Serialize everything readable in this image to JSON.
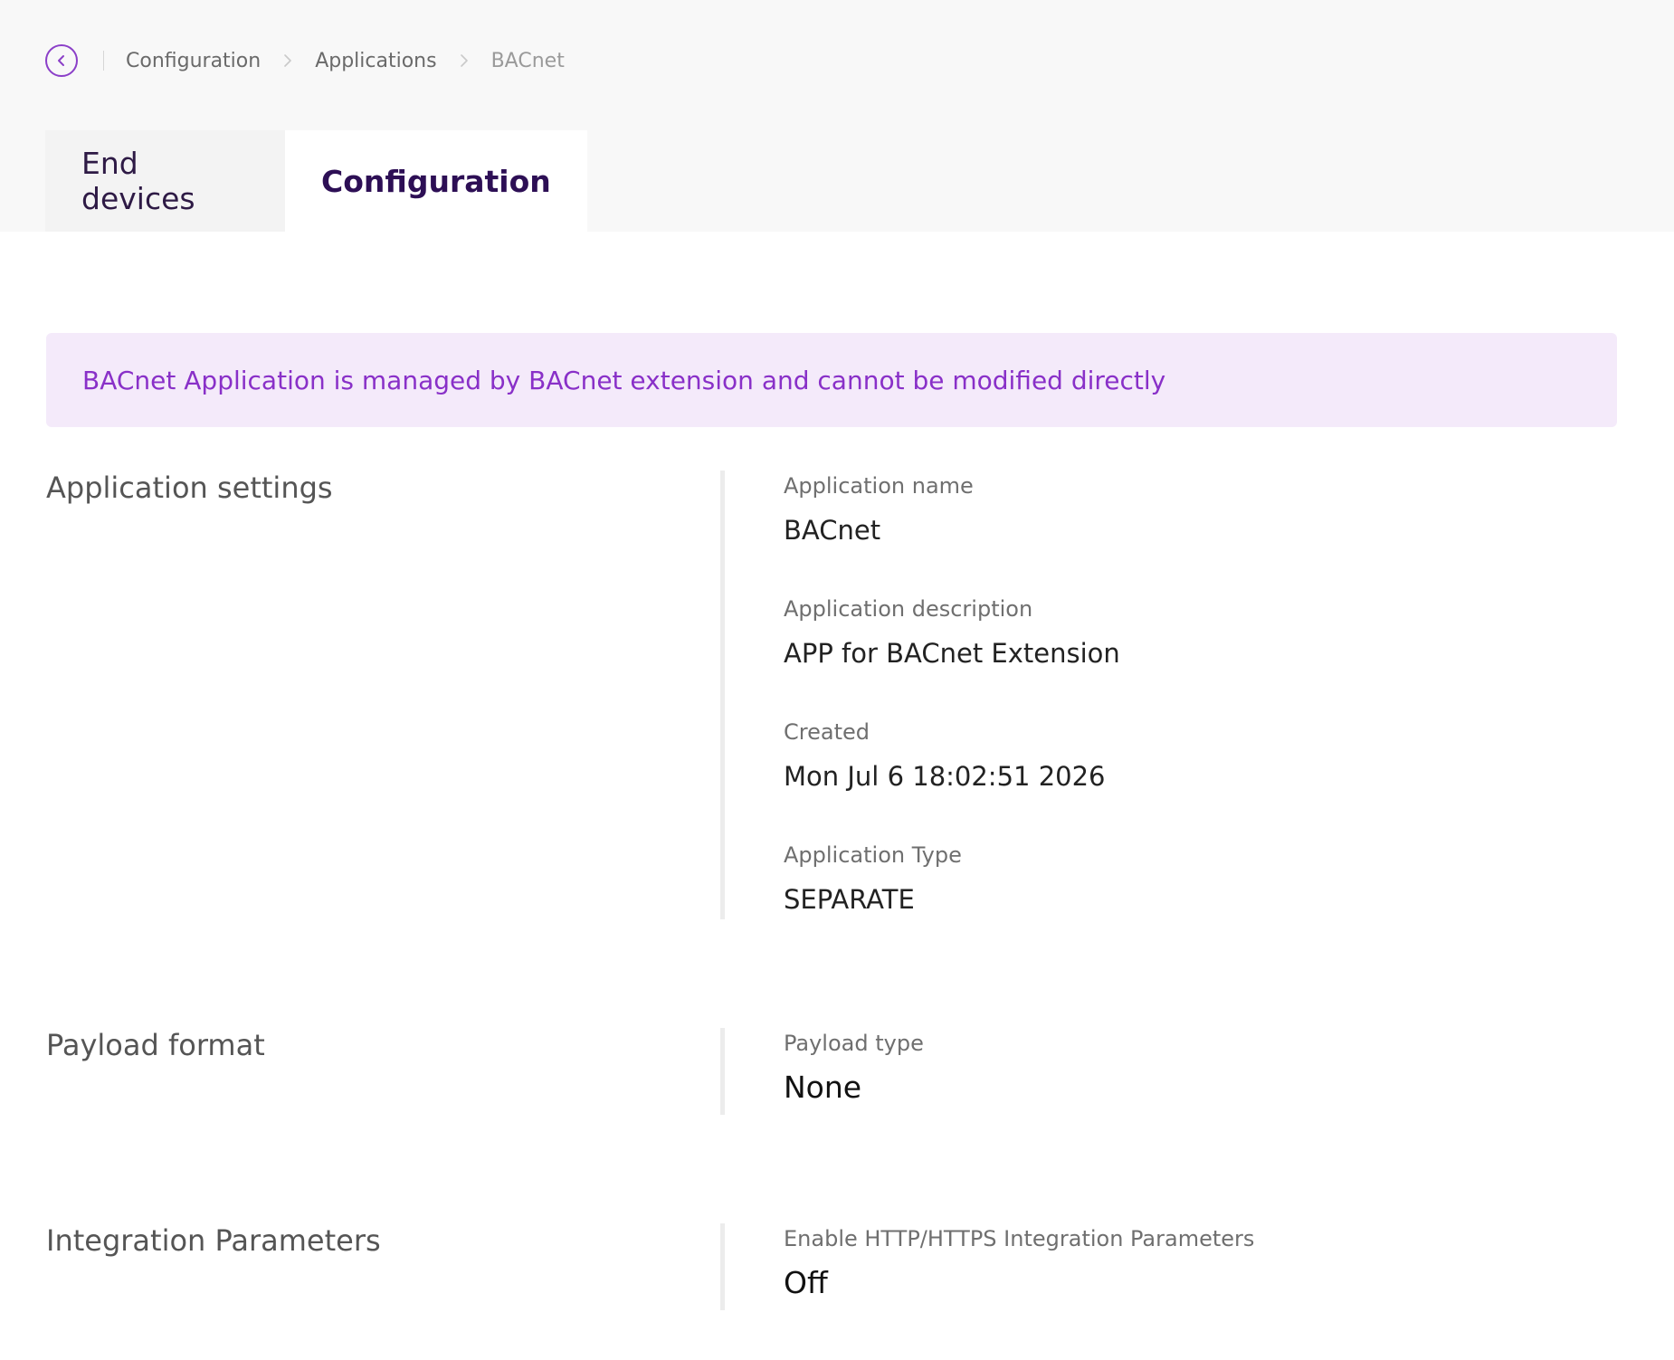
{
  "breadcrumb": {
    "items": [
      "Configuration",
      "Applications"
    ],
    "current": "BACnet"
  },
  "tabs": [
    {
      "label": "End devices",
      "active": false
    },
    {
      "label": "Configuration",
      "active": true
    }
  ],
  "notice": {
    "text": "BACnet Application is managed by BACnet extension and cannot be modified directly"
  },
  "application_settings": {
    "title": "Application settings",
    "fields": [
      {
        "label": "Application name",
        "value": "BACnet"
      },
      {
        "label": "Application description",
        "value": "APP for BACnet Extension"
      },
      {
        "label": "Created",
        "value": "Mon Jul 6 18:02:51 2026"
      },
      {
        "label": "Application Type",
        "value": "SEPARATE"
      }
    ]
  },
  "payload_format": {
    "title": "Payload format",
    "field": {
      "label": "Payload type",
      "value": "None"
    }
  },
  "integration_parameters": {
    "title": "Integration Parameters",
    "field": {
      "label": "Enable HTTP/HTTPS Integration Parameters",
      "value": "Off"
    }
  },
  "colors": {
    "accent": "#8b3fc8",
    "notice_bg": "#f4eafa",
    "notice_text": "#8930c8",
    "top_band": "#f8f8f8"
  },
  "icons": {
    "back": "chevron-left-circle-icon",
    "separator": "chevron-right-icon"
  }
}
